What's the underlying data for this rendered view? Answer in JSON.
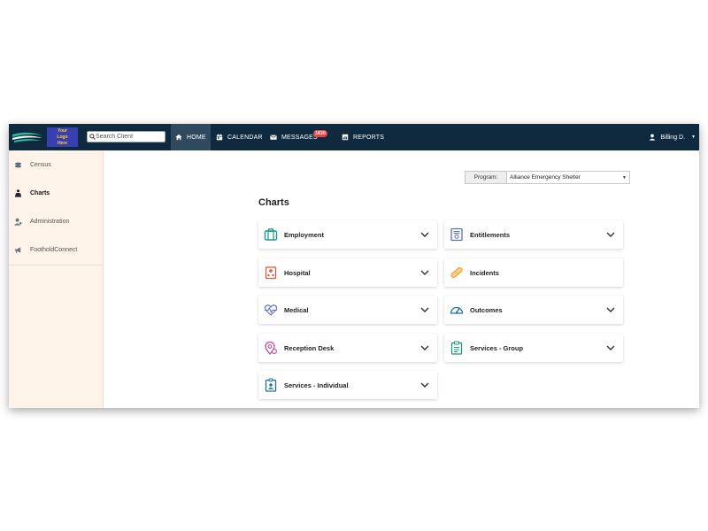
{
  "logo": {
    "text": "Your Logo Here"
  },
  "search": {
    "placeholder": "Search Client"
  },
  "nav": {
    "home": "HOME",
    "calendar": "CALENDAR",
    "messages": "MESSAGES",
    "messages_badge": "1830",
    "reports": "REPORTS"
  },
  "user": {
    "name": "Billing D."
  },
  "sidebar": {
    "items": [
      {
        "label": "Census",
        "icon": "census-icon"
      },
      {
        "label": "Charts",
        "icon": "charts-person-icon",
        "active": true
      },
      {
        "label": "Administration",
        "icon": "admin-icon"
      },
      {
        "label": "FootholdConnect",
        "icon": "megaphone-icon"
      }
    ]
  },
  "program": {
    "label": "Program:",
    "value": "Alliance Emergency Shelter"
  },
  "main": {
    "title": "Charts",
    "cards": [
      {
        "label": "Employment",
        "icon": "briefcase-icon",
        "color": "#1a9a8a"
      },
      {
        "label": "Entitlements",
        "icon": "certificate-icon",
        "color": "#5a6fc9"
      },
      {
        "label": "Hospital",
        "icon": "hospital-icon",
        "color": "#e0553b"
      },
      {
        "label": "Incidents",
        "icon": "bandage-icon",
        "color": "#f0a032"
      },
      {
        "label": "Medical",
        "icon": "heartbeat-icon",
        "color": "#6a6fd0"
      },
      {
        "label": "Outcomes",
        "icon": "gauge-icon",
        "color": "#1e6fa3"
      },
      {
        "label": "Reception Desk",
        "icon": "location-pin-icon",
        "color": "#c04a9a"
      },
      {
        "label": "Services - Group",
        "icon": "clipboard-icon",
        "color": "#1a9a7a"
      },
      {
        "label": "Services - Individual",
        "icon": "id-badge-icon",
        "color": "#1e6fa3"
      }
    ]
  },
  "colors": {
    "topbar": "#0f2a3f",
    "active_tab": "#2f4a5f",
    "sidebar": "#fdf3e9",
    "badge": "#e64545"
  }
}
